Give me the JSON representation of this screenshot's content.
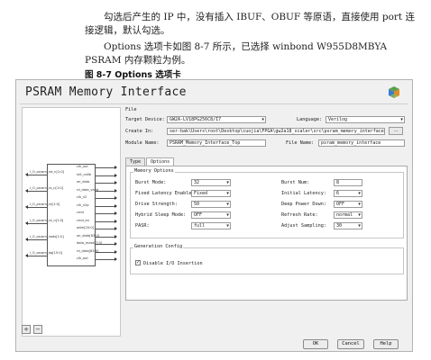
{
  "doc": {
    "paragraph1": "勾选后产生的 IP 中，没有插入 IBUF、OBUF 等原语，直接使用 port 连接逻辑，默认勾选。",
    "paragraph2": "Options 选项卡如图 8-7 所示，已选择 winbond W955D8MBYA PSRAM 内存颗粒为例。",
    "figure_caption": "图 8-7 Options 选项卡"
  },
  "dialog": {
    "title": "PSRAM Memory Interface",
    "logo_icon": "ip-cube-logo",
    "file_group": "File",
    "target_device_label": "Target Device:",
    "target_device_value": "GW2A-LV18PG256C8/I7",
    "language_label": "Language:",
    "language_value": "Verilog",
    "create_in_label": "Create In:",
    "create_in_value": "ser-bak\\Users\\root\\Desktop\\cuojia\\FPGA\\gw2a18_scaler\\src\\psram_memory_interface",
    "browse_label": "...",
    "module_name_label": "Module Name:",
    "module_name_value": "PSRAM_Memory_Interface_Top",
    "file_name_label": "File Name:",
    "file_name_value": "psram_memory_interface",
    "tabs": [
      "Type",
      "Options"
    ],
    "memory_options_title": "Memory Options",
    "memory_options": [
      {
        "label": "Burst Mode:",
        "value": "32",
        "label2": "Burst Num:",
        "value2": "8",
        "field2": true
      },
      {
        "label": "Fixed Latency Enable:",
        "value": "Fixed",
        "label2": "Initial Latency:",
        "value2": "6"
      },
      {
        "label": "Drive Strength:",
        "value": "50",
        "label2": "Deep Power Down:",
        "value2": "OFF"
      },
      {
        "label": "Hybrid Sleep Mode:",
        "value": "OFF",
        "label2": "Refresh Rate:",
        "value2": "normal"
      },
      {
        "label": "PASR:",
        "value": "full",
        "label2": "Adjust Sampling:",
        "value2": "30"
      }
    ],
    "generation_title": "Generation Config",
    "disable_io_label": "Disable I/O Insertion",
    "disable_io_checked": true,
    "buttons": {
      "ok": "OK",
      "cancel": "Cancel",
      "help": "Help"
    },
    "zoom_in_icon": "zoom-in-icon",
    "zoom_out_icon": "zoom-out-icon"
  },
  "symbol": {
    "left_pins": [
      "I_O_psram_rst_n[1:0]",
      "I_O_psram_cs_n[1:0]",
      "I_O_psram_ck[1:0]",
      "I_O_psram_ck_n[1:0]",
      "I_O_psram_rwds[1:0]",
      "I_O_psram_dq[15:0]"
    ],
    "right_pins": [
      "clk_out",
      "init_calib",
      "wr_data",
      "rd_data_valid",
      "clk_x2",
      "clk_x2p",
      "cmd",
      "cmd_en",
      "addr[20:0]",
      "wr_data[63:0]",
      "data_mask[7:0]",
      "rd_data[63:0]",
      "clk_out"
    ]
  },
  "colors": {
    "logo_blue": "#3a7bd5",
    "logo_green": "#5aa04a",
    "logo_orange": "#e08a2a"
  }
}
